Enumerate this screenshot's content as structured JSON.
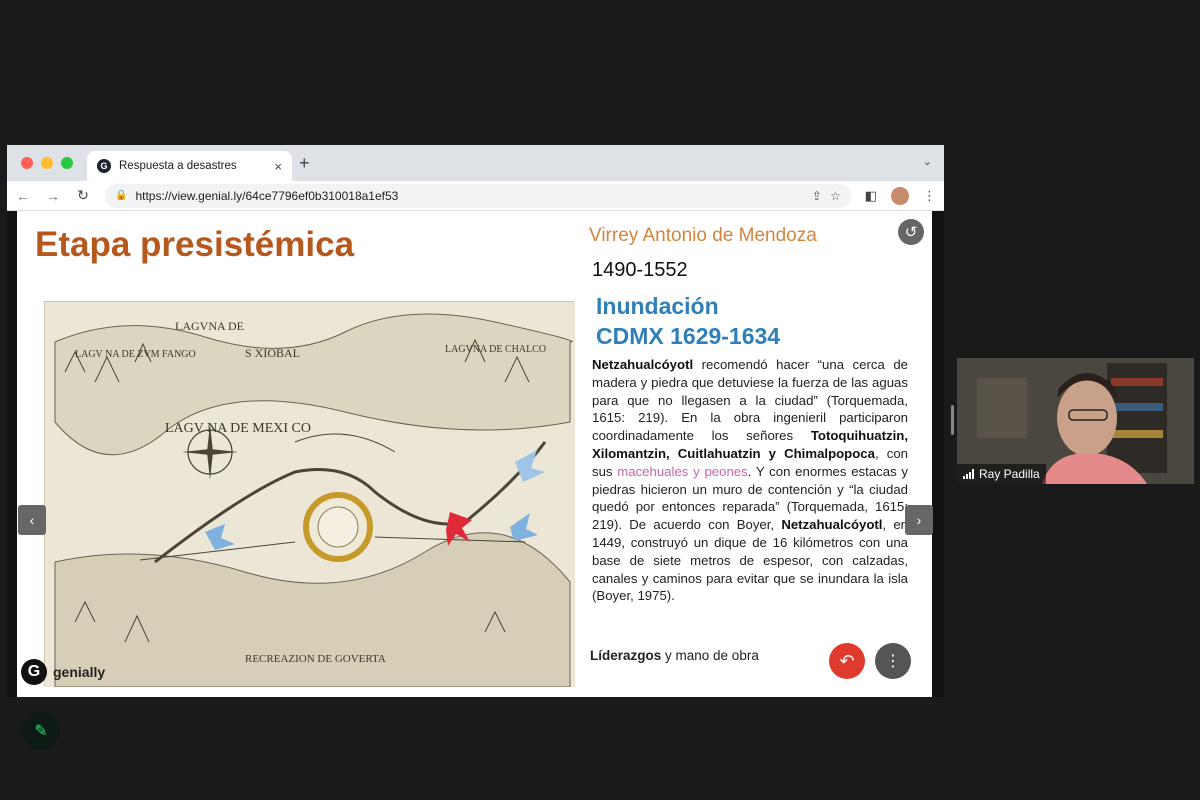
{
  "browser": {
    "tab_title": "Respuesta a desastres",
    "tab_favicon_letter": "G",
    "tab_close": "×",
    "new_tab": "+",
    "tab_menu": "⌄",
    "url": "https://view.genial.ly/64ce7796ef0b310018a1ef53"
  },
  "slide": {
    "title": "Etapa presistémica",
    "viceroy": "Virrey Antonio de Mendoza",
    "years": "1490-1552",
    "flood_line1": "Inundación",
    "flood_line2": "CDMX 1629-1634",
    "body": {
      "p1_bold": "Netzahualcóyotl",
      "p1": " recomendó hacer “una cerca de madera y piedra que detuviese la fuerza de las aguas para que no llegasen a la ciudad” (Torquemada, 1615: 219). En la obra ingenieril participaron coordinadamente los señores ",
      "p2_bold": "Totoquihuatzin, Xilomantzin, Cuitlahuatzin y Chimalpopoca",
      "p2": ", con sus ",
      "p2_pink": "macehuales y peones",
      "p3": ". Y con enormes estacas y piedras hicieron un muro de contención y “la ciudad quedó por entonces reparada” (Torquemada, 1615: 219). De acuerdo con Boyer, ",
      "p3_bold": "Netzahualcóyotl",
      "p4": ", en 1449, construyó un dique de 16 kilómetros con una base de siete metros de espesor, con calzadas, canales y caminos para evitar que se inundara la isla (Boyer, 1975)."
    },
    "leaders_bold": "Líderazgos",
    "leaders_rest": " y mano de obra",
    "logo_letter": "G",
    "logo_text": "genially",
    "map_labels": {
      "l1": "LAGVNA DE",
      "l2": "S XIOBAL",
      "l3": "LAGV NA DE ZVM FANGO",
      "l4": "LAGVNA DE CHALCO",
      "l5": "LAGV NA DE MEXI CO",
      "l6": "RECREAZION DE GOVERTA"
    }
  },
  "video": {
    "participant_name": "Ray Padilla"
  },
  "colors": {
    "title": "#b4581e",
    "viceroy": "#d4853e",
    "flood": "#2f7fb8",
    "pink": "#c567ae",
    "back_button": "#e03a2f"
  }
}
